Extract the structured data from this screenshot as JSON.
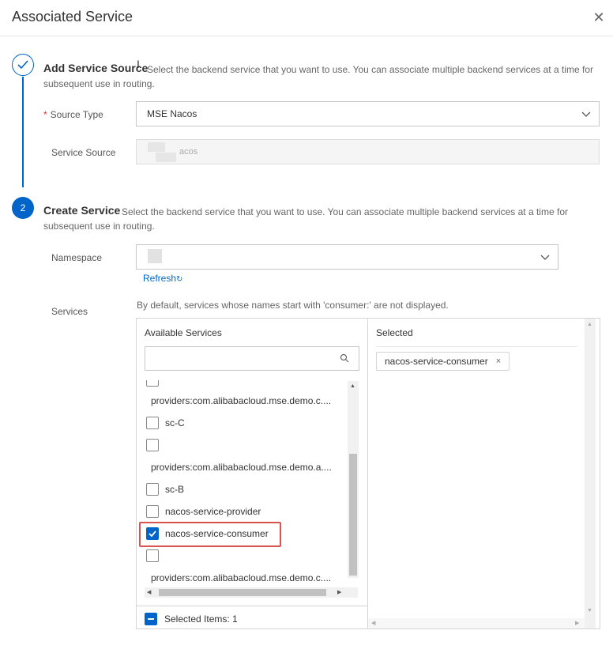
{
  "dialog": {
    "title": "Associated Service",
    "close_glyph": "✕"
  },
  "step1": {
    "title": "Add Service Source",
    "description": "Select the backend service that you want to use. You can associate multiple backend services at a time for subsequent use in routing.",
    "source_type_label": "Source Type",
    "source_type_value": "MSE Nacos",
    "service_source_label": "Service Source",
    "service_source_value": "acos"
  },
  "step2": {
    "number": "2",
    "title": "Create Service",
    "description": "Select the backend service that you want to use. You can associate multiple backend services at a time for subsequent use in routing.",
    "namespace_label": "Namespace",
    "refresh_label": "Refresh",
    "refresh_glyph": "↻",
    "services_label": "Services",
    "services_hint": "By default, services whose names start with 'consumer:' are not displayed."
  },
  "transfer": {
    "available_title": "Available Services",
    "selected_title": "Selected",
    "search_placeholder": "",
    "items": [
      {
        "label": "providers:com.alibabacloud.mse.demo.c....",
        "checked": false
      },
      {
        "label": "sc-C",
        "checked": false
      },
      {
        "label": "providers:com.alibabacloud.mse.demo.a....",
        "checked": false
      },
      {
        "label": "sc-B",
        "checked": false
      },
      {
        "label": "nacos-service-provider",
        "checked": false
      },
      {
        "label": "nacos-service-consumer",
        "checked": true
      },
      {
        "label": "providers:com.alibabacloud.mse.demo.c....",
        "checked": false
      }
    ],
    "selected_items": [
      {
        "label": "nacos-service-consumer",
        "remove_glyph": "×"
      }
    ],
    "footer_label": "Selected Items: 1"
  },
  "colors": {
    "primary": "#0064c8",
    "highlight": "#d9534f",
    "required": "#d93026"
  }
}
